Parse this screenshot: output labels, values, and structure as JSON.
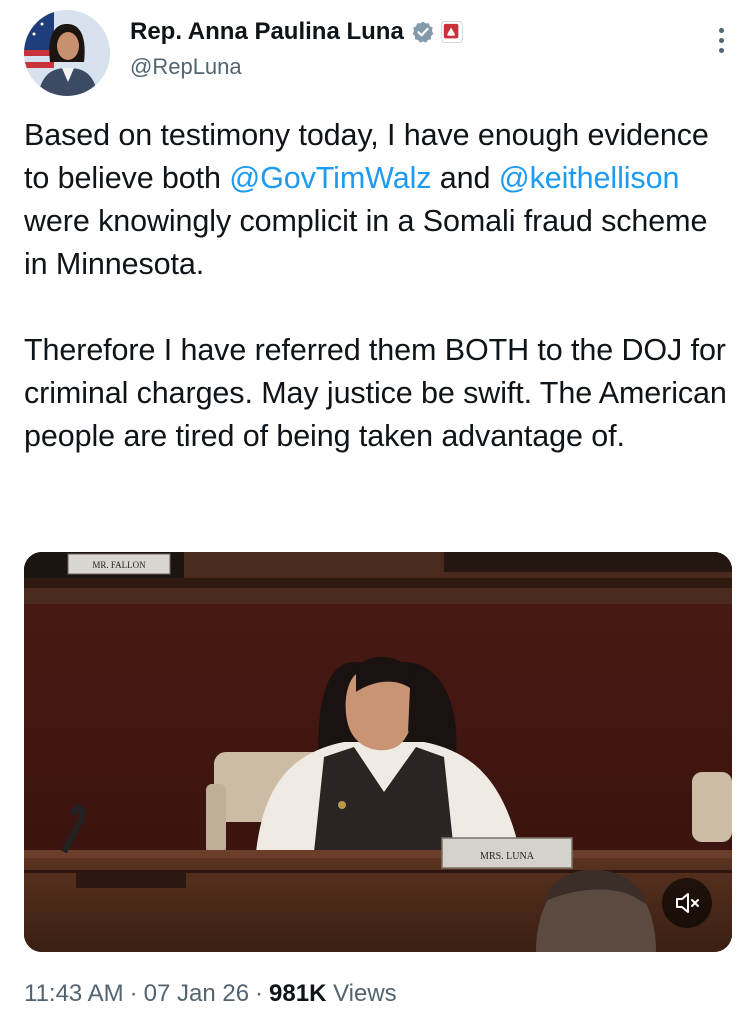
{
  "author": {
    "display_name": "Rep. Anna Paulina Luna",
    "handle": "@RepLuna",
    "avatar_icon": "user-avatar",
    "verified_icon": "verified-badge-icon",
    "affiliation_icon": "government-affiliation-icon"
  },
  "menu": {
    "icon": "more-options-icon"
  },
  "tweet": {
    "p1_a": "Based on testimony today, I have enough evidence to believe both ",
    "mention_1": "@GovTimWalz",
    "p1_b": " and ",
    "mention_2": "@keithellison",
    "p1_c": " were knowingly complicit in a Somali fraud scheme in Minnesota.",
    "p2": "Therefore I have referred them BOTH to the DOJ for criminal charges. May justice be swift. The American people are tired of being taken advantage of."
  },
  "media": {
    "nameplate_top": "MR. FALLON",
    "nameplate_speaker": "MRS. LUNA",
    "mute_icon": "muted-speaker-icon"
  },
  "footer": {
    "time": "11:43 AM",
    "date": "07 Jan 26",
    "views_count": "981K",
    "views_label": "Views",
    "separator": "·"
  },
  "colors": {
    "link": "#1d9bf0",
    "text": "#0f1419",
    "secondary": "#536471"
  }
}
